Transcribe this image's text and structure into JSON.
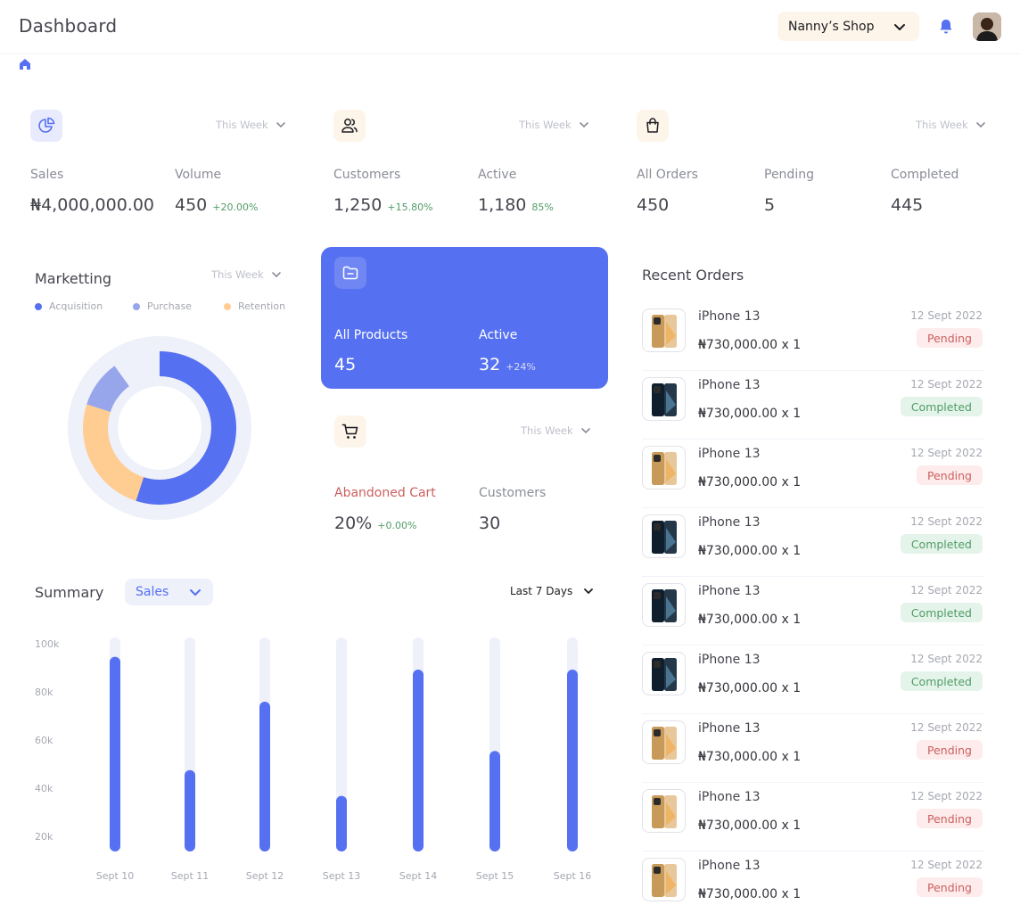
{
  "header": {
    "title": "Dashboard",
    "shop": "Nanny’s Shop"
  },
  "colors": {
    "accent": "#5570F1",
    "secondary": "#97A5EB",
    "tertiary": "#FFCC91",
    "track": "#EEF0FA"
  },
  "stats": {
    "sales_card": {
      "period": "This Week",
      "sales_label": "Sales",
      "sales_value": "₦4,000,000.00",
      "volume_label": "Volume",
      "volume_value": "450",
      "volume_delta": "+20.00%"
    },
    "customers_card": {
      "period": "This Week",
      "customers_label": "Customers",
      "customers_value": "1,250",
      "customers_delta": "+15.80%",
      "active_label": "Active",
      "active_value": "1,180",
      "active_delta": "85%"
    },
    "orders_card": {
      "period": "This Week",
      "all_label": "All Orders",
      "all_value": "450",
      "pending_label": "Pending",
      "pending_value": "5",
      "completed_label": "Completed",
      "completed_value": "445"
    }
  },
  "marketing": {
    "title": "Marketting",
    "period": "This Week",
    "legend": [
      "Acquisition",
      "Purchase",
      "Retention"
    ],
    "shares": {
      "acquisition": 0.55,
      "purchase": 0.1,
      "retention": 0.25
    }
  },
  "products": {
    "all_label": "All Products",
    "all_value": "45",
    "active_label": "Active",
    "active_value": "32",
    "active_delta": "+24%"
  },
  "cart": {
    "period": "This Week",
    "abandoned_label": "Abandoned Cart",
    "abandoned_value": "20%",
    "abandoned_delta": "+0.00%",
    "customers_label": "Customers",
    "customers_value": "30"
  },
  "summary": {
    "title": "Summary",
    "metric": "Sales",
    "range": "Last 7 Days"
  },
  "chart_data": {
    "type": "bar",
    "categories": [
      "Sept 10",
      "Sept 11",
      "Sept 12",
      "Sept 13",
      "Sept 14",
      "Sept 15",
      "Sept 16"
    ],
    "values": [
      91000,
      38000,
      70000,
      26000,
      85000,
      47000,
      85000
    ],
    "yticks": [
      "20k",
      "40k",
      "60k",
      "80k",
      "100k"
    ],
    "ylim": [
      0,
      100000
    ],
    "grid": false
  },
  "recent_orders": {
    "title": "Recent Orders",
    "items": [
      {
        "name": "iPhone 13",
        "price": "₦730,000.00 x 1",
        "date": "12 Sept 2022",
        "status": "Pending",
        "color": "gold"
      },
      {
        "name": "iPhone 13",
        "price": "₦730,000.00 x 1",
        "date": "12 Sept 2022",
        "status": "Completed",
        "color": "blue"
      },
      {
        "name": "iPhone 13",
        "price": "₦730,000.00 x 1",
        "date": "12 Sept 2022",
        "status": "Pending",
        "color": "gold"
      },
      {
        "name": "iPhone 13",
        "price": "₦730,000.00 x 1",
        "date": "12 Sept 2022",
        "status": "Completed",
        "color": "blue"
      },
      {
        "name": "iPhone 13",
        "price": "₦730,000.00 x 1",
        "date": "12 Sept 2022",
        "status": "Completed",
        "color": "blue"
      },
      {
        "name": "iPhone 13",
        "price": "₦730,000.00 x 1",
        "date": "12 Sept 2022",
        "status": "Completed",
        "color": "blue"
      },
      {
        "name": "iPhone 13",
        "price": "₦730,000.00 x 1",
        "date": "12 Sept 2022",
        "status": "Pending",
        "color": "gold"
      },
      {
        "name": "iPhone 13",
        "price": "₦730,000.00 x 1",
        "date": "12 Sept 2022",
        "status": "Pending",
        "color": "gold"
      },
      {
        "name": "iPhone 13",
        "price": "₦730,000.00 x 1",
        "date": "12 Sept 2022",
        "status": "Pending",
        "color": "gold"
      }
    ]
  }
}
